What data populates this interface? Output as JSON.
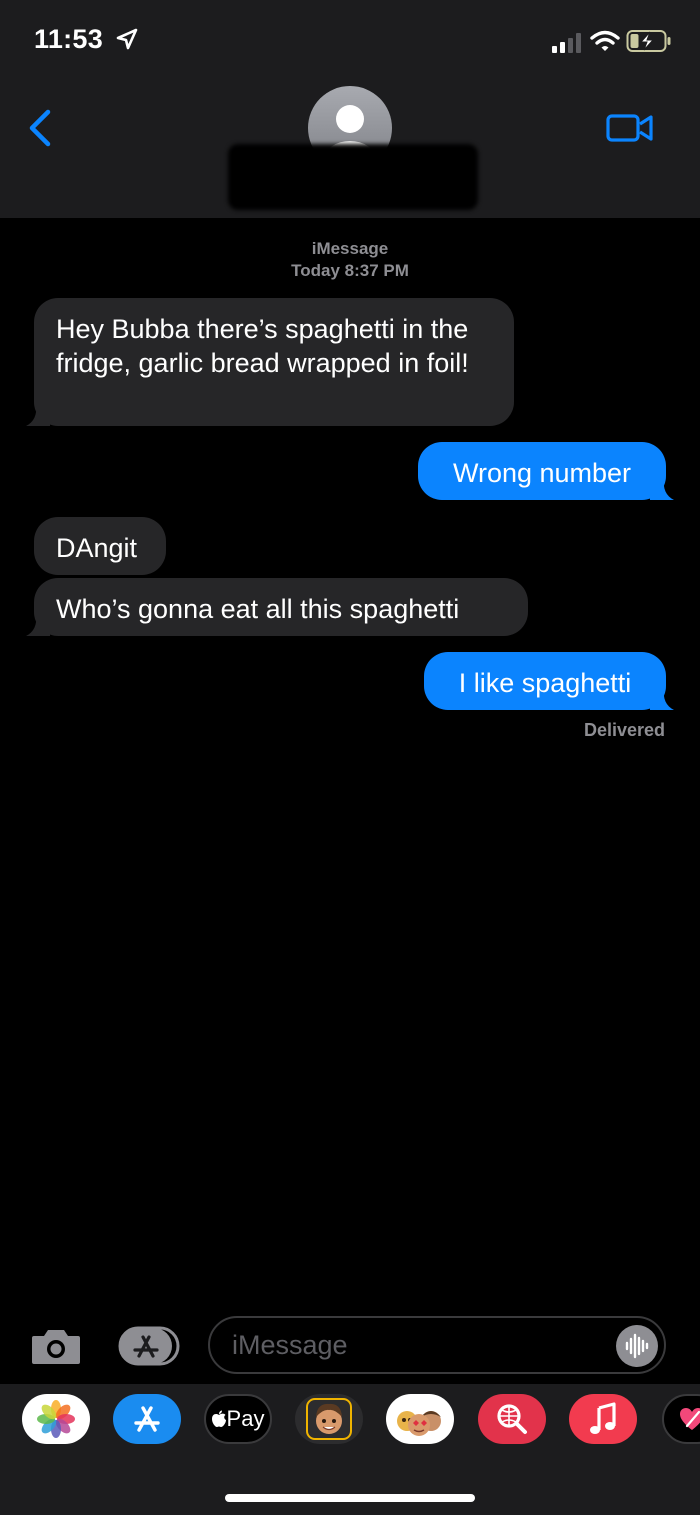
{
  "status_bar": {
    "time": "11:53",
    "icons": [
      "location-arrow-icon",
      "cellular-signal-icon",
      "wifi-icon",
      "battery-charging-icon"
    ]
  },
  "header": {
    "icons": [
      "back-chevron-icon",
      "contact-avatar-icon",
      "facetime-video-icon"
    ],
    "accent_color": "#0b84fe"
  },
  "conversation": {
    "service": "iMessage",
    "timestamp": "Today 8:37 PM",
    "messages": [
      {
        "direction": "incoming",
        "text": "Hey Bubba there’s spaghetti in the fridge, garlic bread wrapped in foil!"
      },
      {
        "direction": "outgoing",
        "text": "Wrong number"
      },
      {
        "direction": "incoming",
        "text": "DAngit"
      },
      {
        "direction": "incoming",
        "text": "Who’s gonna eat all this spaghetti"
      },
      {
        "direction": "outgoing",
        "text": "I like spaghetti"
      }
    ],
    "status": "Delivered",
    "incoming_color": "#262628",
    "outgoing_color": "#0b84fe"
  },
  "composer": {
    "placeholder": "iMessage",
    "icons": [
      "camera-icon",
      "app-store-icon",
      "audio-waveform-icon"
    ]
  },
  "app_drawer": {
    "apps": [
      {
        "icon": "photos-icon"
      },
      {
        "icon": "app-store-icon"
      },
      {
        "icon": "apple-pay-icon",
        "label": "Pay"
      },
      {
        "icon": "memoji-icon"
      },
      {
        "icon": "memoji-stickers-icon"
      },
      {
        "icon": "images-search-icon"
      },
      {
        "icon": "music-icon"
      },
      {
        "icon": "digital-touch-icon"
      }
    ]
  }
}
